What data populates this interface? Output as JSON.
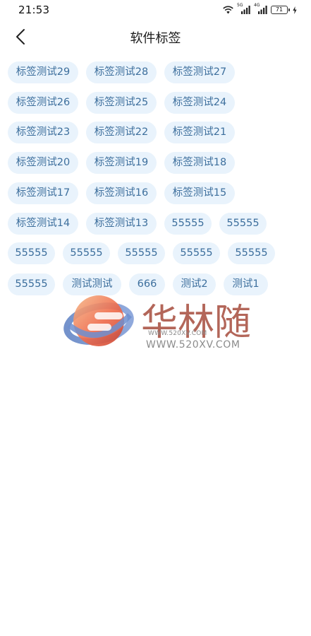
{
  "status_bar": {
    "time": "21:53",
    "signal_1_tag": "5G",
    "signal_2_tag": "4G",
    "battery": "71"
  },
  "header": {
    "title": "软件标签"
  },
  "tags": [
    "标签测试29",
    "标签测试28",
    "标签测试27",
    "标签测试26",
    "标签测试25",
    "标签测试24",
    "标签测试23",
    "标签测试22",
    "标签测试21",
    "标签测试20",
    "标签测试19",
    "标签测试18",
    "标签测试17",
    "标签测试16",
    "标签测试15",
    "标签测试14",
    "标签测试13",
    "55555",
    "55555",
    "55555",
    "55555",
    "55555",
    "55555",
    "55555",
    "55555",
    "测试测试",
    "666",
    "测试2",
    "测试1"
  ],
  "watermark": {
    "logo_text": "华林随",
    "url_small": "WWW.520XV.COM",
    "url": "WWW.520XV.COM"
  },
  "icons": {
    "back": "chevron-left-icon",
    "wifi": "wifi-icon",
    "signal": "cell-signal-icon",
    "battery": "battery-icon",
    "charging": "bolt-icon"
  },
  "colors": {
    "tag_bg": "#e9f3fc",
    "tag_text": "#3d6f9d",
    "title_text": "#1a1a1a"
  }
}
